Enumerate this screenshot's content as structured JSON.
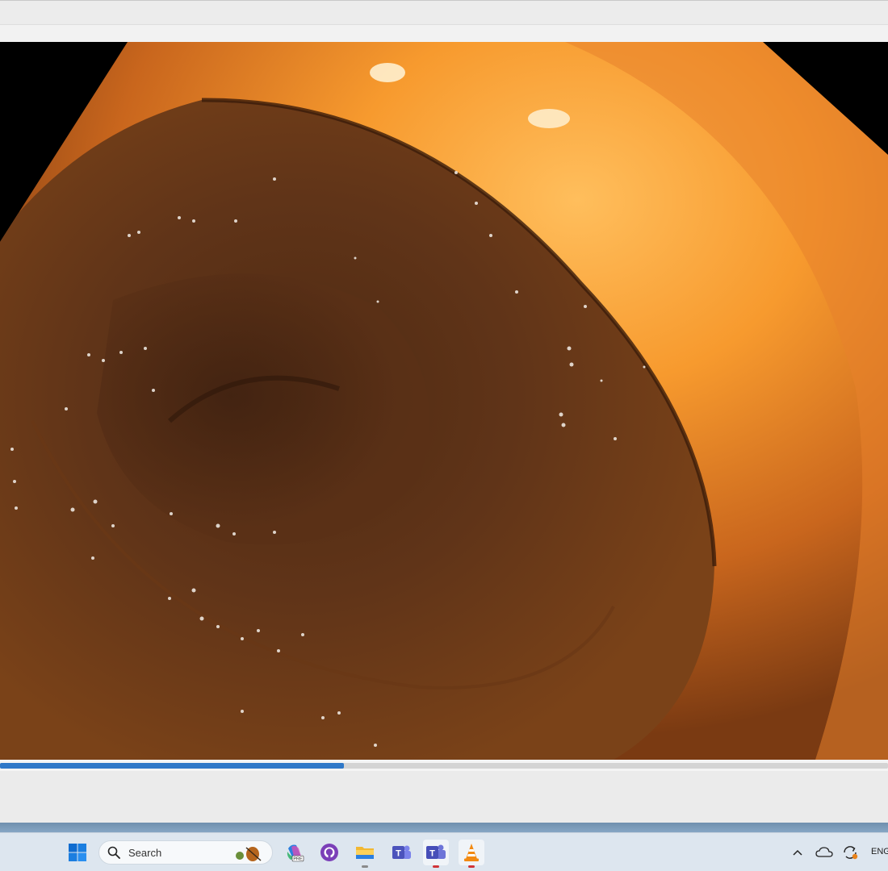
{
  "taskbar": {
    "search_label": "Search",
    "language": "ENG",
    "pinned_apps": [
      "start-icon",
      "copilot-icon",
      "github-icon",
      "file-explorer-icon",
      "teams-icon",
      "teams-classic-icon",
      "vlc-icon"
    ]
  },
  "player": {
    "progress": 0.387
  },
  "colors": {
    "seek_fill": "#2f78c8",
    "taskbar": "#dde6ef"
  }
}
